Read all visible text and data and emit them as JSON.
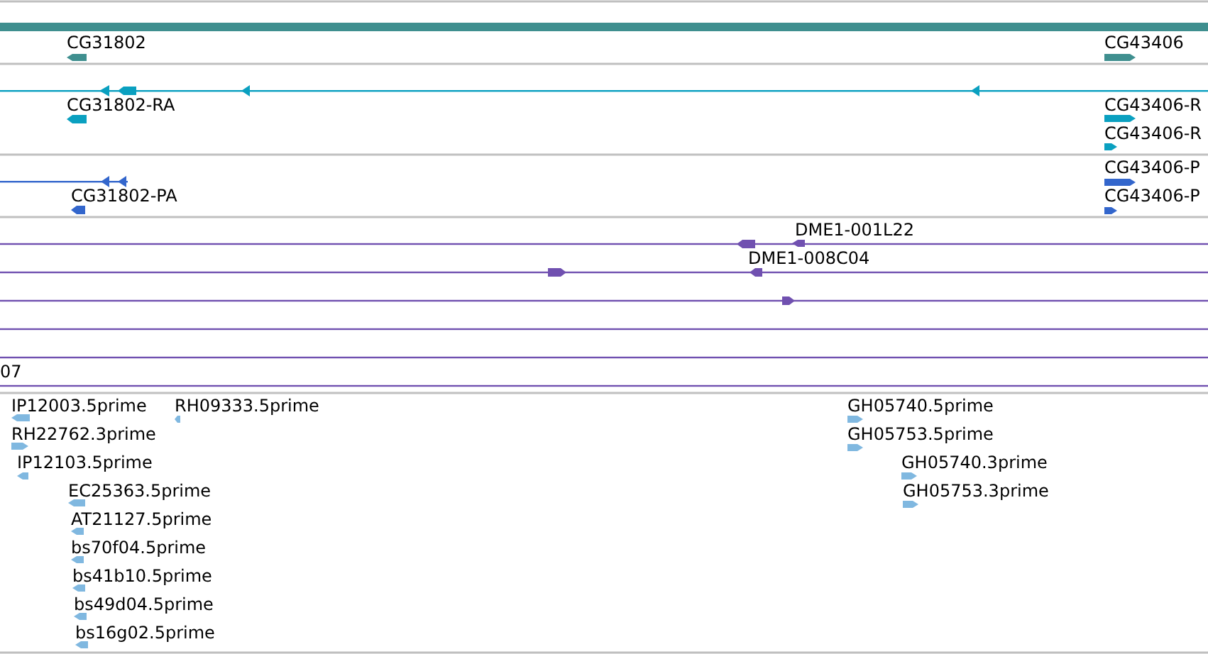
{
  "tracks": [
    {
      "kind": "gene",
      "features": [
        {
          "label": "CG31802",
          "reverse": true
        },
        {
          "label": "CG43406",
          "reverse": false
        }
      ]
    },
    {
      "kind": "transcript",
      "features": [
        {
          "label": "CG31802-RA",
          "reverse": true
        },
        {
          "label": "CG43406-R",
          "reverse": false
        },
        {
          "label": "CG43406-R",
          "reverse": false
        }
      ]
    },
    {
      "kind": "protein",
      "features": [
        {
          "label": "CG31802-PA",
          "reverse": true
        },
        {
          "label": "CG43406-P",
          "reverse": false
        },
        {
          "label": "CG43406-P",
          "reverse": false
        }
      ]
    },
    {
      "kind": "clone",
      "features": [
        {
          "label": "DME1-001L22",
          "reverse": true
        },
        {
          "label": "DME1-008C04",
          "reverse": true
        },
        {
          "label": "07"
        }
      ]
    },
    {
      "kind": "est",
      "features": [
        {
          "label": "IP12003.5prime",
          "reverse": true
        },
        {
          "label": "RH09333.5prime",
          "reverse": true
        },
        {
          "label": "RH22762.3prime",
          "reverse": false
        },
        {
          "label": "IP12103.5prime",
          "reverse": true
        },
        {
          "label": "EC25363.5prime",
          "reverse": true
        },
        {
          "label": "AT21127.5prime",
          "reverse": true
        },
        {
          "label": "bs70f04.5prime",
          "reverse": true
        },
        {
          "label": "bs41b10.5prime",
          "reverse": true
        },
        {
          "label": "bs49d04.5prime",
          "reverse": true
        },
        {
          "label": "bs16g02.5prime",
          "reverse": true
        },
        {
          "label": "GH05740.5prime",
          "reverse": false
        },
        {
          "label": "GH05753.5prime",
          "reverse": false
        },
        {
          "label": "GH05740.3prime",
          "reverse": false
        },
        {
          "label": "GH05753.3prime",
          "reverse": false
        }
      ]
    }
  ]
}
